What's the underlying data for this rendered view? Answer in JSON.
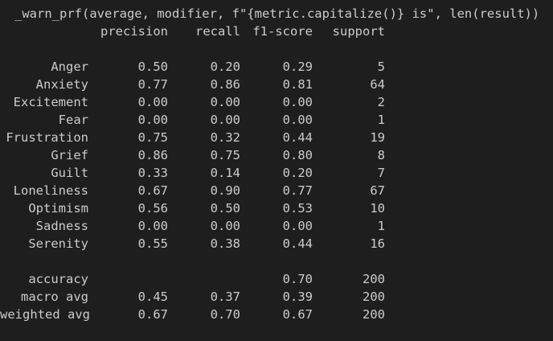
{
  "warning_line": "_warn_prf(average, modifier, f\"{metric.capitalize()} is\", len(result))",
  "report": {
    "headers": {
      "precision": "precision",
      "recall": "recall",
      "f1": "f1-score",
      "support": "support"
    },
    "classes": [
      {
        "label": "Anger",
        "precision": "0.50",
        "recall": "0.20",
        "f1": "0.29",
        "support": "5"
      },
      {
        "label": "Anxiety",
        "precision": "0.77",
        "recall": "0.86",
        "f1": "0.81",
        "support": "64"
      },
      {
        "label": "Excitement",
        "precision": "0.00",
        "recall": "0.00",
        "f1": "0.00",
        "support": "2"
      },
      {
        "label": "Fear",
        "precision": "0.00",
        "recall": "0.00",
        "f1": "0.00",
        "support": "1"
      },
      {
        "label": "Frustration",
        "precision": "0.75",
        "recall": "0.32",
        "f1": "0.44",
        "support": "19"
      },
      {
        "label": "Grief",
        "precision": "0.86",
        "recall": "0.75",
        "f1": "0.80",
        "support": "8"
      },
      {
        "label": "Guilt",
        "precision": "0.33",
        "recall": "0.14",
        "f1": "0.20",
        "support": "7"
      },
      {
        "label": "Loneliness",
        "precision": "0.67",
        "recall": "0.90",
        "f1": "0.77",
        "support": "67"
      },
      {
        "label": "Optimism",
        "precision": "0.56",
        "recall": "0.50",
        "f1": "0.53",
        "support": "10"
      },
      {
        "label": "Sadness",
        "precision": "0.00",
        "recall": "0.00",
        "f1": "0.00",
        "support": "1"
      },
      {
        "label": "Serenity",
        "precision": "0.55",
        "recall": "0.38",
        "f1": "0.44",
        "support": "16"
      }
    ],
    "summary": [
      {
        "label": "accuracy",
        "precision": "",
        "recall": "",
        "f1": "0.70",
        "support": "200"
      },
      {
        "label": "macro avg",
        "precision": "0.45",
        "recall": "0.37",
        "f1": "0.39",
        "support": "200"
      },
      {
        "label": "weighted avg",
        "precision": "0.67",
        "recall": "0.70",
        "f1": "0.67",
        "support": "200"
      }
    ]
  },
  "colors": {
    "background": "#1e1e1e",
    "text": "#cccccc"
  }
}
